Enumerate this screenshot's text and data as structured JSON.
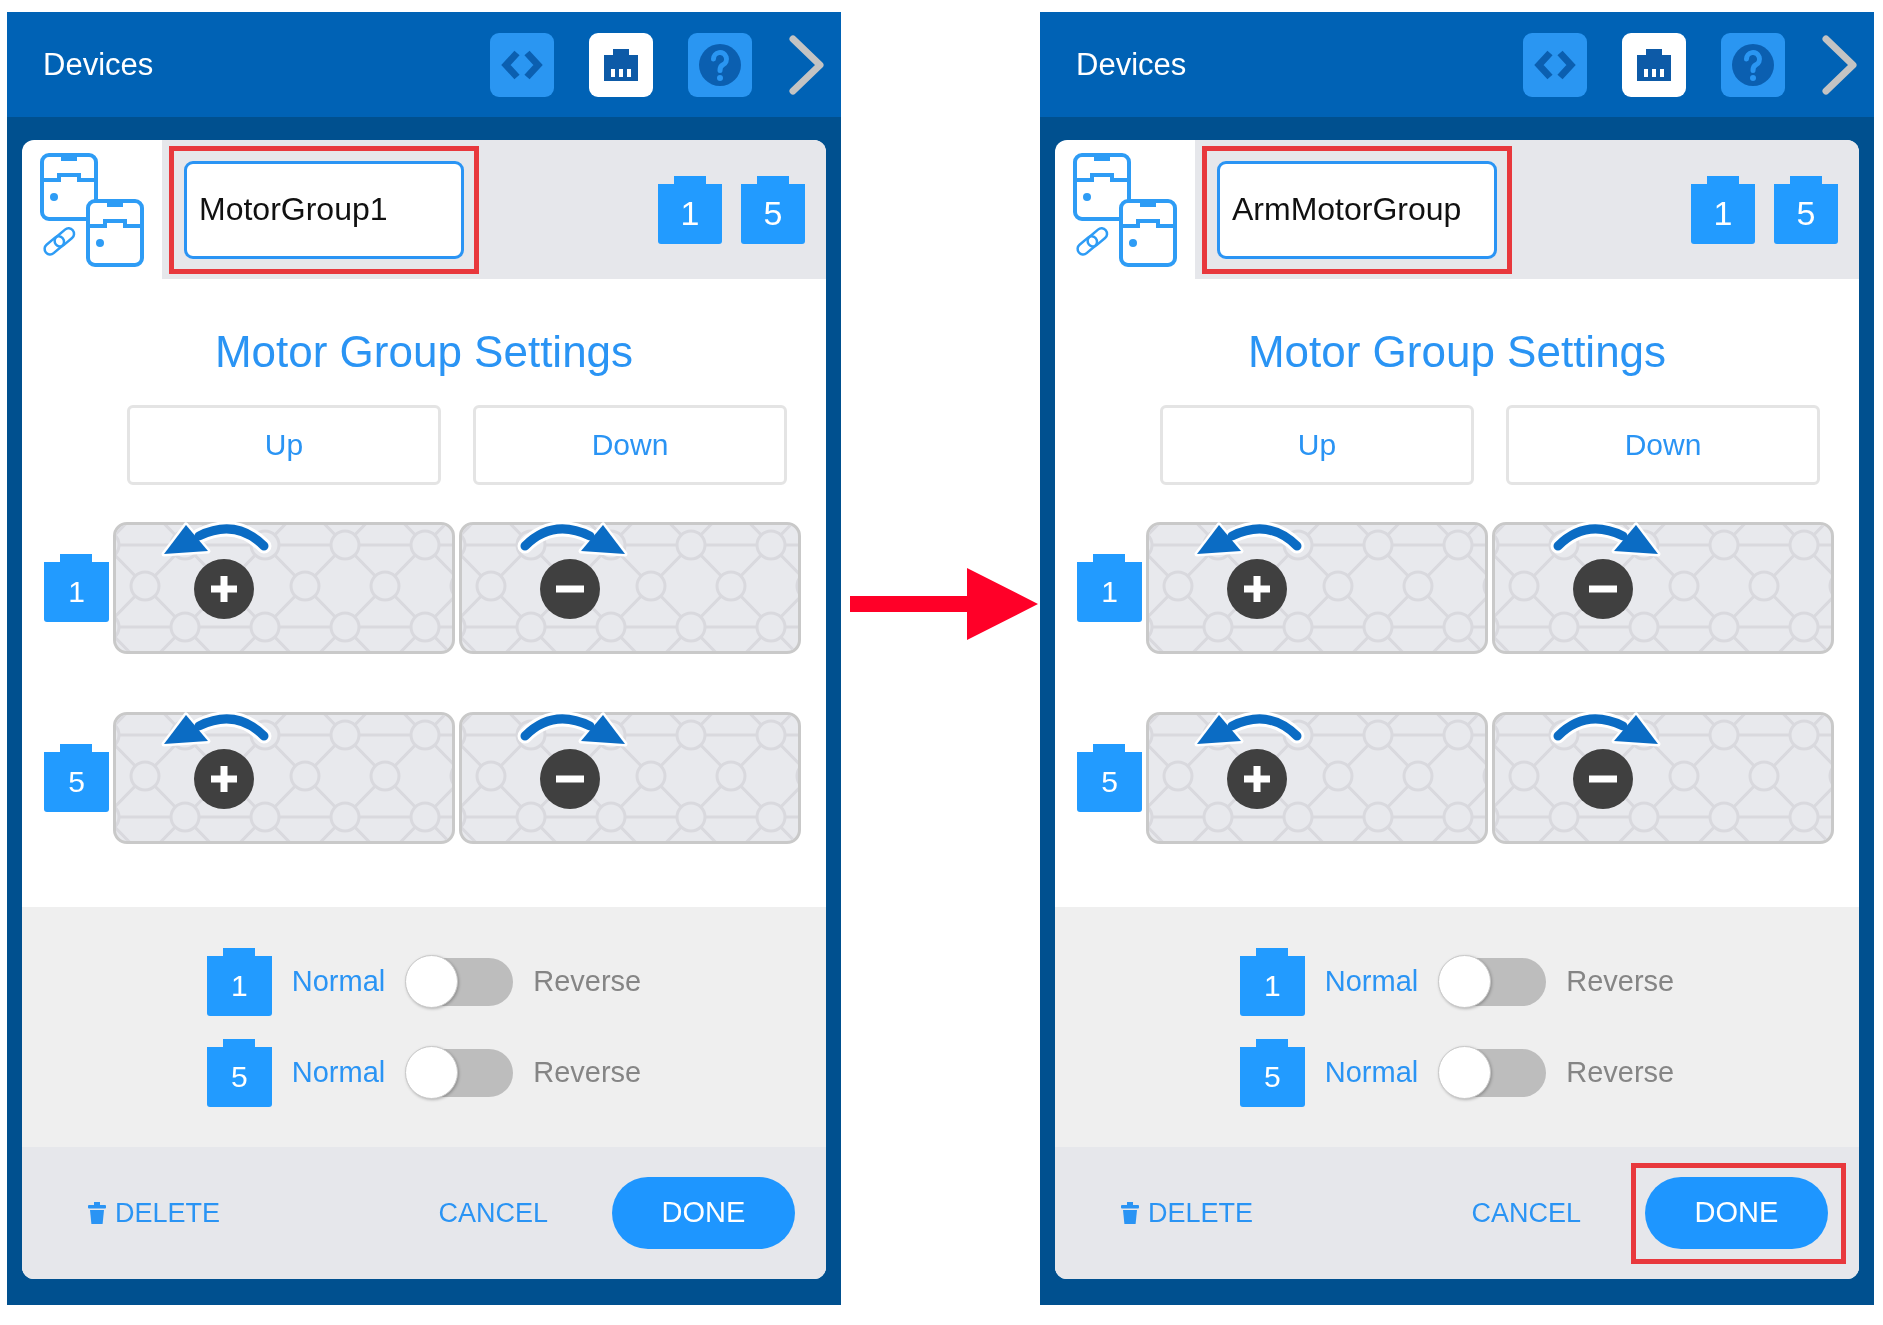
{
  "panels": [
    {
      "header": {
        "title": "Devices",
        "toolbar": [
          {
            "kind": "code",
            "selected": false
          },
          {
            "kind": "port",
            "selected": true
          },
          {
            "kind": "help",
            "selected": false
          }
        ]
      },
      "group_name": {
        "value": "MotorGroup1",
        "highlighted": true
      },
      "ports": [
        "1",
        "5"
      ],
      "settings_title": "Motor Group Settings",
      "columns": [
        {
          "label": "Up",
          "kind": "increase"
        },
        {
          "label": "Down",
          "kind": "decrease"
        }
      ],
      "motor_rows": [
        {
          "port": "1"
        },
        {
          "port": "5"
        }
      ],
      "directions": [
        {
          "port": "1",
          "normal_label": "Normal",
          "reverse_label": "Reverse",
          "reversed": false
        },
        {
          "port": "5",
          "normal_label": "Normal",
          "reverse_label": "Reverse",
          "reversed": false
        }
      ],
      "footer": {
        "delete_label": "DELETE",
        "cancel_label": "CANCEL",
        "done": {
          "label": "DONE",
          "highlighted": false
        }
      }
    },
    {
      "header": {
        "title": "Devices",
        "toolbar": [
          {
            "kind": "code",
            "selected": false
          },
          {
            "kind": "port",
            "selected": true
          },
          {
            "kind": "help",
            "selected": false
          }
        ]
      },
      "group_name": {
        "value": "ArmMotorGroup",
        "highlighted": true
      },
      "ports": [
        "1",
        "5"
      ],
      "settings_title": "Motor Group Settings",
      "columns": [
        {
          "label": "Up",
          "kind": "increase"
        },
        {
          "label": "Down",
          "kind": "decrease"
        }
      ],
      "motor_rows": [
        {
          "port": "1"
        },
        {
          "port": "5"
        }
      ],
      "directions": [
        {
          "port": "1",
          "normal_label": "Normal",
          "reverse_label": "Reverse",
          "reversed": false
        },
        {
          "port": "5",
          "normal_label": "Normal",
          "reverse_label": "Reverse",
          "reversed": false
        }
      ],
      "footer": {
        "delete_label": "DELETE",
        "cancel_label": "CANCEL",
        "done": {
          "label": "DONE",
          "highlighted": true
        }
      }
    }
  ]
}
